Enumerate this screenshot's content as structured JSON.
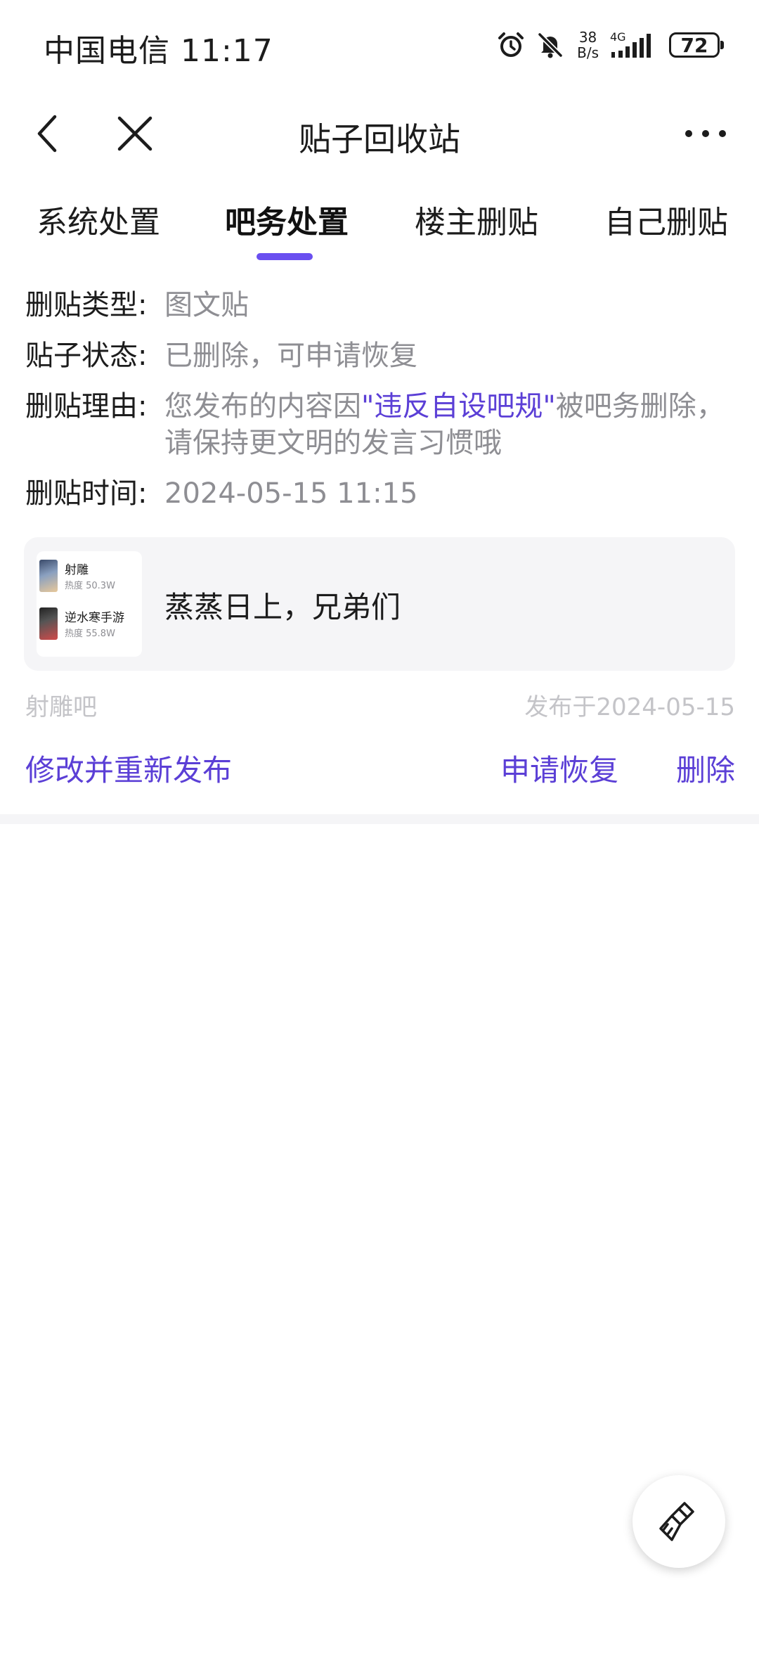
{
  "status_bar": {
    "carrier_time": "中国电信 11:17",
    "net_speed_value": "38",
    "net_speed_unit": "B/s",
    "network": "4G",
    "battery": "72"
  },
  "nav": {
    "title": "贴子回收站"
  },
  "tabs": [
    {
      "label": "系统处置"
    },
    {
      "label": "吧务处置"
    },
    {
      "label": "楼主删贴"
    },
    {
      "label": "自己删贴"
    }
  ],
  "info": {
    "type_label": "删贴类型:",
    "type_value": "图文贴",
    "status_label": "贴子状态:",
    "status_value": "已删除，可申请恢复",
    "reason_label": "删贴理由:",
    "reason_prefix": "您发布的内容因",
    "reason_highlight": "\"违反自设吧规\"",
    "reason_suffix": "被吧务删除，请保持更文明的发言习惯哦",
    "time_label": "删贴时间:",
    "time_value": "2024-05-15 11:15"
  },
  "post": {
    "thumb_items": [
      {
        "name": "射雕",
        "heat": "热度 50.3W"
      },
      {
        "name": "逆水寒手游",
        "heat": "热度 55.8W"
      }
    ],
    "text": "蒸蒸日上，兄弟们",
    "forum": "射雕吧",
    "published": "发布于2024-05-15"
  },
  "actions": {
    "repost": "修改并重新发布",
    "restore": "申请恢复",
    "delete": "删除"
  },
  "colors": {
    "accent": "#5b3fd6",
    "tab_indicator": "#6a4ff0",
    "muted": "#8e8e93"
  }
}
